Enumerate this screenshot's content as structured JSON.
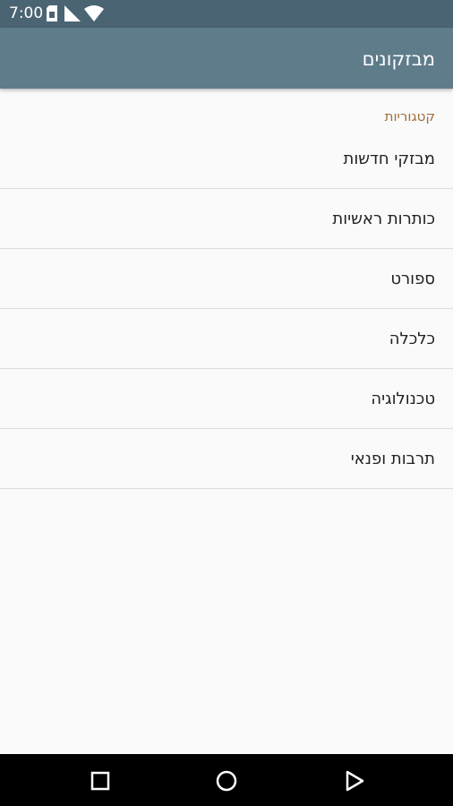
{
  "status_bar": {
    "time": "7:00"
  },
  "app_bar": {
    "title": "מבזקונים"
  },
  "categories": {
    "header": "קטגוריות",
    "items": [
      {
        "label": "מבזקי חדשות"
      },
      {
        "label": "כותרות ראשיות"
      },
      {
        "label": "ספורט"
      },
      {
        "label": "כלכלה"
      },
      {
        "label": "טכנולוגיה"
      },
      {
        "label": "תרבות ופנאי"
      }
    ]
  },
  "colors": {
    "status_bar_bg": "#4b6473",
    "app_bar_bg": "#5f7c8b",
    "section_header": "#a06c3b",
    "background": "#fafafa"
  },
  "icons": {
    "status": [
      "sim-card-icon",
      "signal-icon",
      "wifi-icon"
    ],
    "nav": [
      "recents-square-icon",
      "home-circle-icon",
      "back-triangle-icon"
    ]
  }
}
